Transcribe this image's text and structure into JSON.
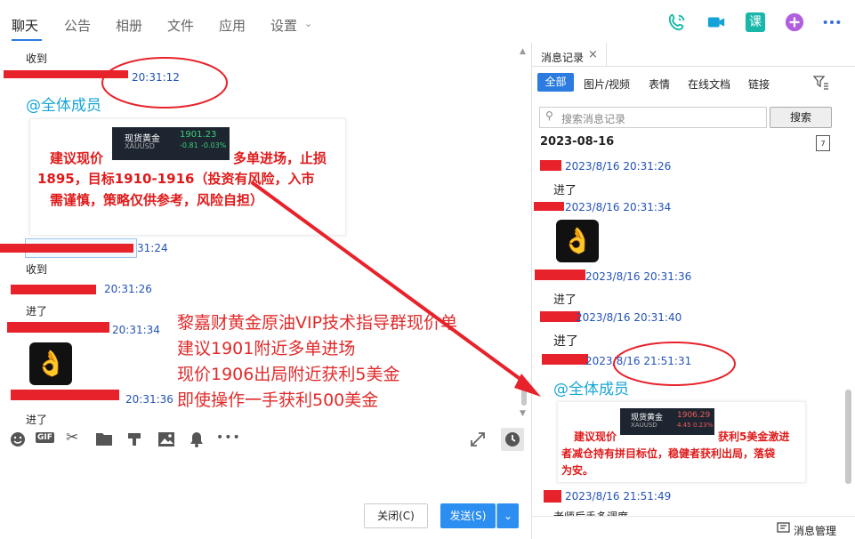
{
  "tabs": [
    "聊天",
    "公告",
    "相册",
    "文件",
    "应用",
    "设置"
  ],
  "header_icons": [
    "phone-icon",
    "video-icon",
    "course-icon",
    "add-app-icon",
    "more-icon"
  ],
  "header_icon_labels": {
    "course": "课"
  },
  "chat": {
    "messages": [
      {
        "text": "收到"
      },
      {
        "time": "20:31:12"
      },
      {
        "mention": "@全体成员"
      },
      {
        "time": "31:24"
      },
      {
        "text": "收到"
      },
      {
        "time": "20:31:26"
      },
      {
        "text": "进了"
      },
      {
        "time": "20:31:34"
      },
      {
        "time": "20:31:36"
      },
      {
        "text": "进了"
      }
    ],
    "card": {
      "ticker_name": "现货黄金",
      "ticker_code": "XAUUSD",
      "ticker_price": "1901.23",
      "ticker_change": "-0.81",
      "ticker_pct": "-0.03%",
      "line1_left": "建议现价",
      "line1_right": "多单进场，止损",
      "line2": "1895，目标1910-1916（投资有风险，入市",
      "line3": "需谨慎，策略仅供参考，风险自担）"
    },
    "overlay_text": [
      "黎嘉财黄金原油VIP技术指导群现价单",
      "建议1901附近多单进场",
      "现价1906出局附近获利5美金",
      "即使操作一手获利500美金"
    ]
  },
  "toolbar": {
    "icons": [
      "emoji-icon",
      "gif-icon",
      "screenshot-icon",
      "folder-icon",
      "doc-icon",
      "image-icon",
      "bell-icon",
      "more-icon"
    ],
    "gif_label": "GIF",
    "expand_icon": "expand-icon",
    "history_icon": "clock-icon"
  },
  "compose": {
    "close_label": "关闭(C)",
    "send_label": "发送(S)"
  },
  "history": {
    "tab_label": "消息记录",
    "filters": [
      "全部",
      "图片/视频",
      "表情",
      "在线文档",
      "链接"
    ],
    "search_placeholder": "搜索消息记录",
    "search_button": "搜索",
    "date": "2023-08-16",
    "calendar_day": "7",
    "entries": [
      {
        "time": "2023/8/16 20:31:26",
        "text": "进了"
      },
      {
        "time": "2023/8/16 20:31:34"
      },
      {
        "time": "2023/8/16 20:31:36",
        "text": "进了"
      },
      {
        "time": "2023/8/16 20:31:40",
        "text": "进了"
      },
      {
        "time": "2023/8/16 21:51:31",
        "mention": "@全体成员"
      },
      {
        "time": "2023/8/16 21:51:49",
        "text": "老师后手多调度"
      }
    ],
    "card": {
      "ticker_name": "现货黄金",
      "ticker_code": "XAUUSD",
      "ticker_price": "1906.29",
      "ticker_change": "4.45",
      "ticker_pct": "0.23%",
      "line1_left": "建议现价",
      "line1_right": "获利5美金激进",
      "line2": "者减仓持有拼目标位，稳健者获利出局，落袋",
      "line3": "为安。"
    },
    "manage_label": "消息管理"
  },
  "colors": {
    "accent": "#2b7be0",
    "annotation": "#e8222b",
    "mention": "#18a5d6",
    "time": "#2453b8"
  }
}
